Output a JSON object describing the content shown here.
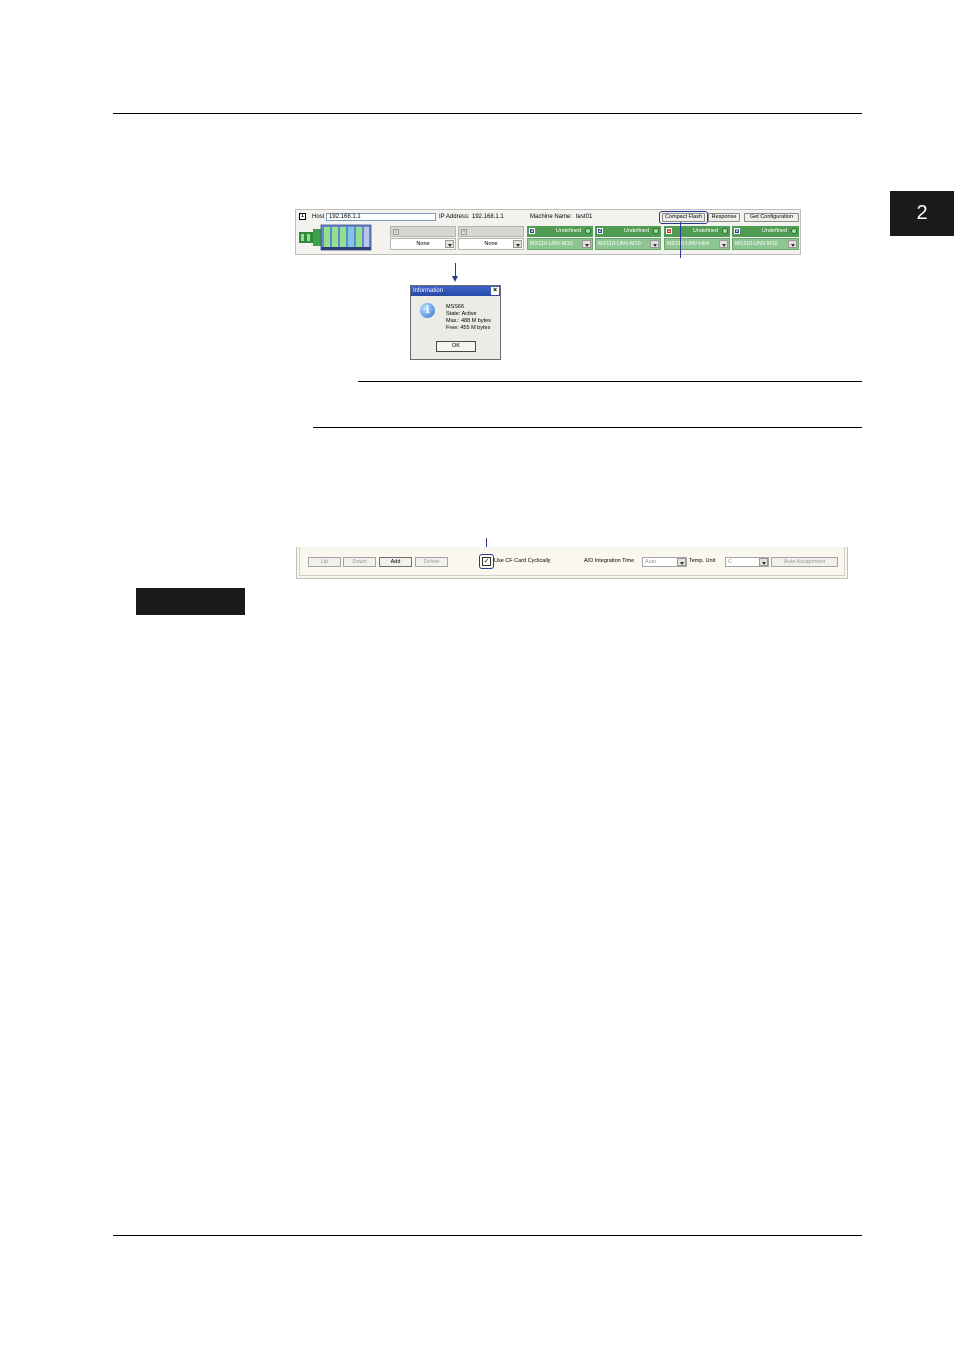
{
  "chapter_number": "2",
  "toolbar": {
    "host_label": "Host",
    "host_value": "192.168.1.1",
    "ip_label": "IP Address:",
    "ip_value": "192.168.1.1",
    "machine_label": "Machine Name:",
    "machine_value": "test01",
    "btn_compact_flash": "Compact Flash",
    "btn_response": "Response",
    "btn_get_configuration": "Get Configuration",
    "slots": [
      {
        "number": "5",
        "head": "",
        "select": "None",
        "style": "empty"
      },
      {
        "number": "4",
        "head": "",
        "select": "None",
        "style": "empty"
      },
      {
        "number": "3",
        "head": "Undefined",
        "select": "MX110-UNV-M10",
        "style": "green"
      },
      {
        "number": "2",
        "head": "Undefined",
        "select": "MX110-UNV-M10",
        "style": "green"
      },
      {
        "number": "1",
        "head": "Undefined",
        "select": "MX110-UNV-H04",
        "style": "green"
      },
      {
        "number": "0",
        "head": "Undefined",
        "select": "MX110-UNV-M10",
        "style": "green"
      }
    ]
  },
  "dialog": {
    "title": "Information",
    "close_label": "×",
    "lines": [
      "MSS66",
      "State: Active",
      "Max.: 488 M bytes",
      "Free: 455 M bytes"
    ],
    "ok_label": "OK"
  },
  "bottom_bar": {
    "btn_up": "Up",
    "btn_down": "Down",
    "btn_add": "Add",
    "btn_delete": "Delete",
    "checkbox_label": "Use CF Card Cyclically",
    "checkbox_checked": true,
    "ad_label": "A/D Integration Time",
    "ad_value": "Auto",
    "temp_label": "Temp. Unit",
    "temp_value": "C",
    "btn_auto_assignment": "Auto Assignment"
  }
}
